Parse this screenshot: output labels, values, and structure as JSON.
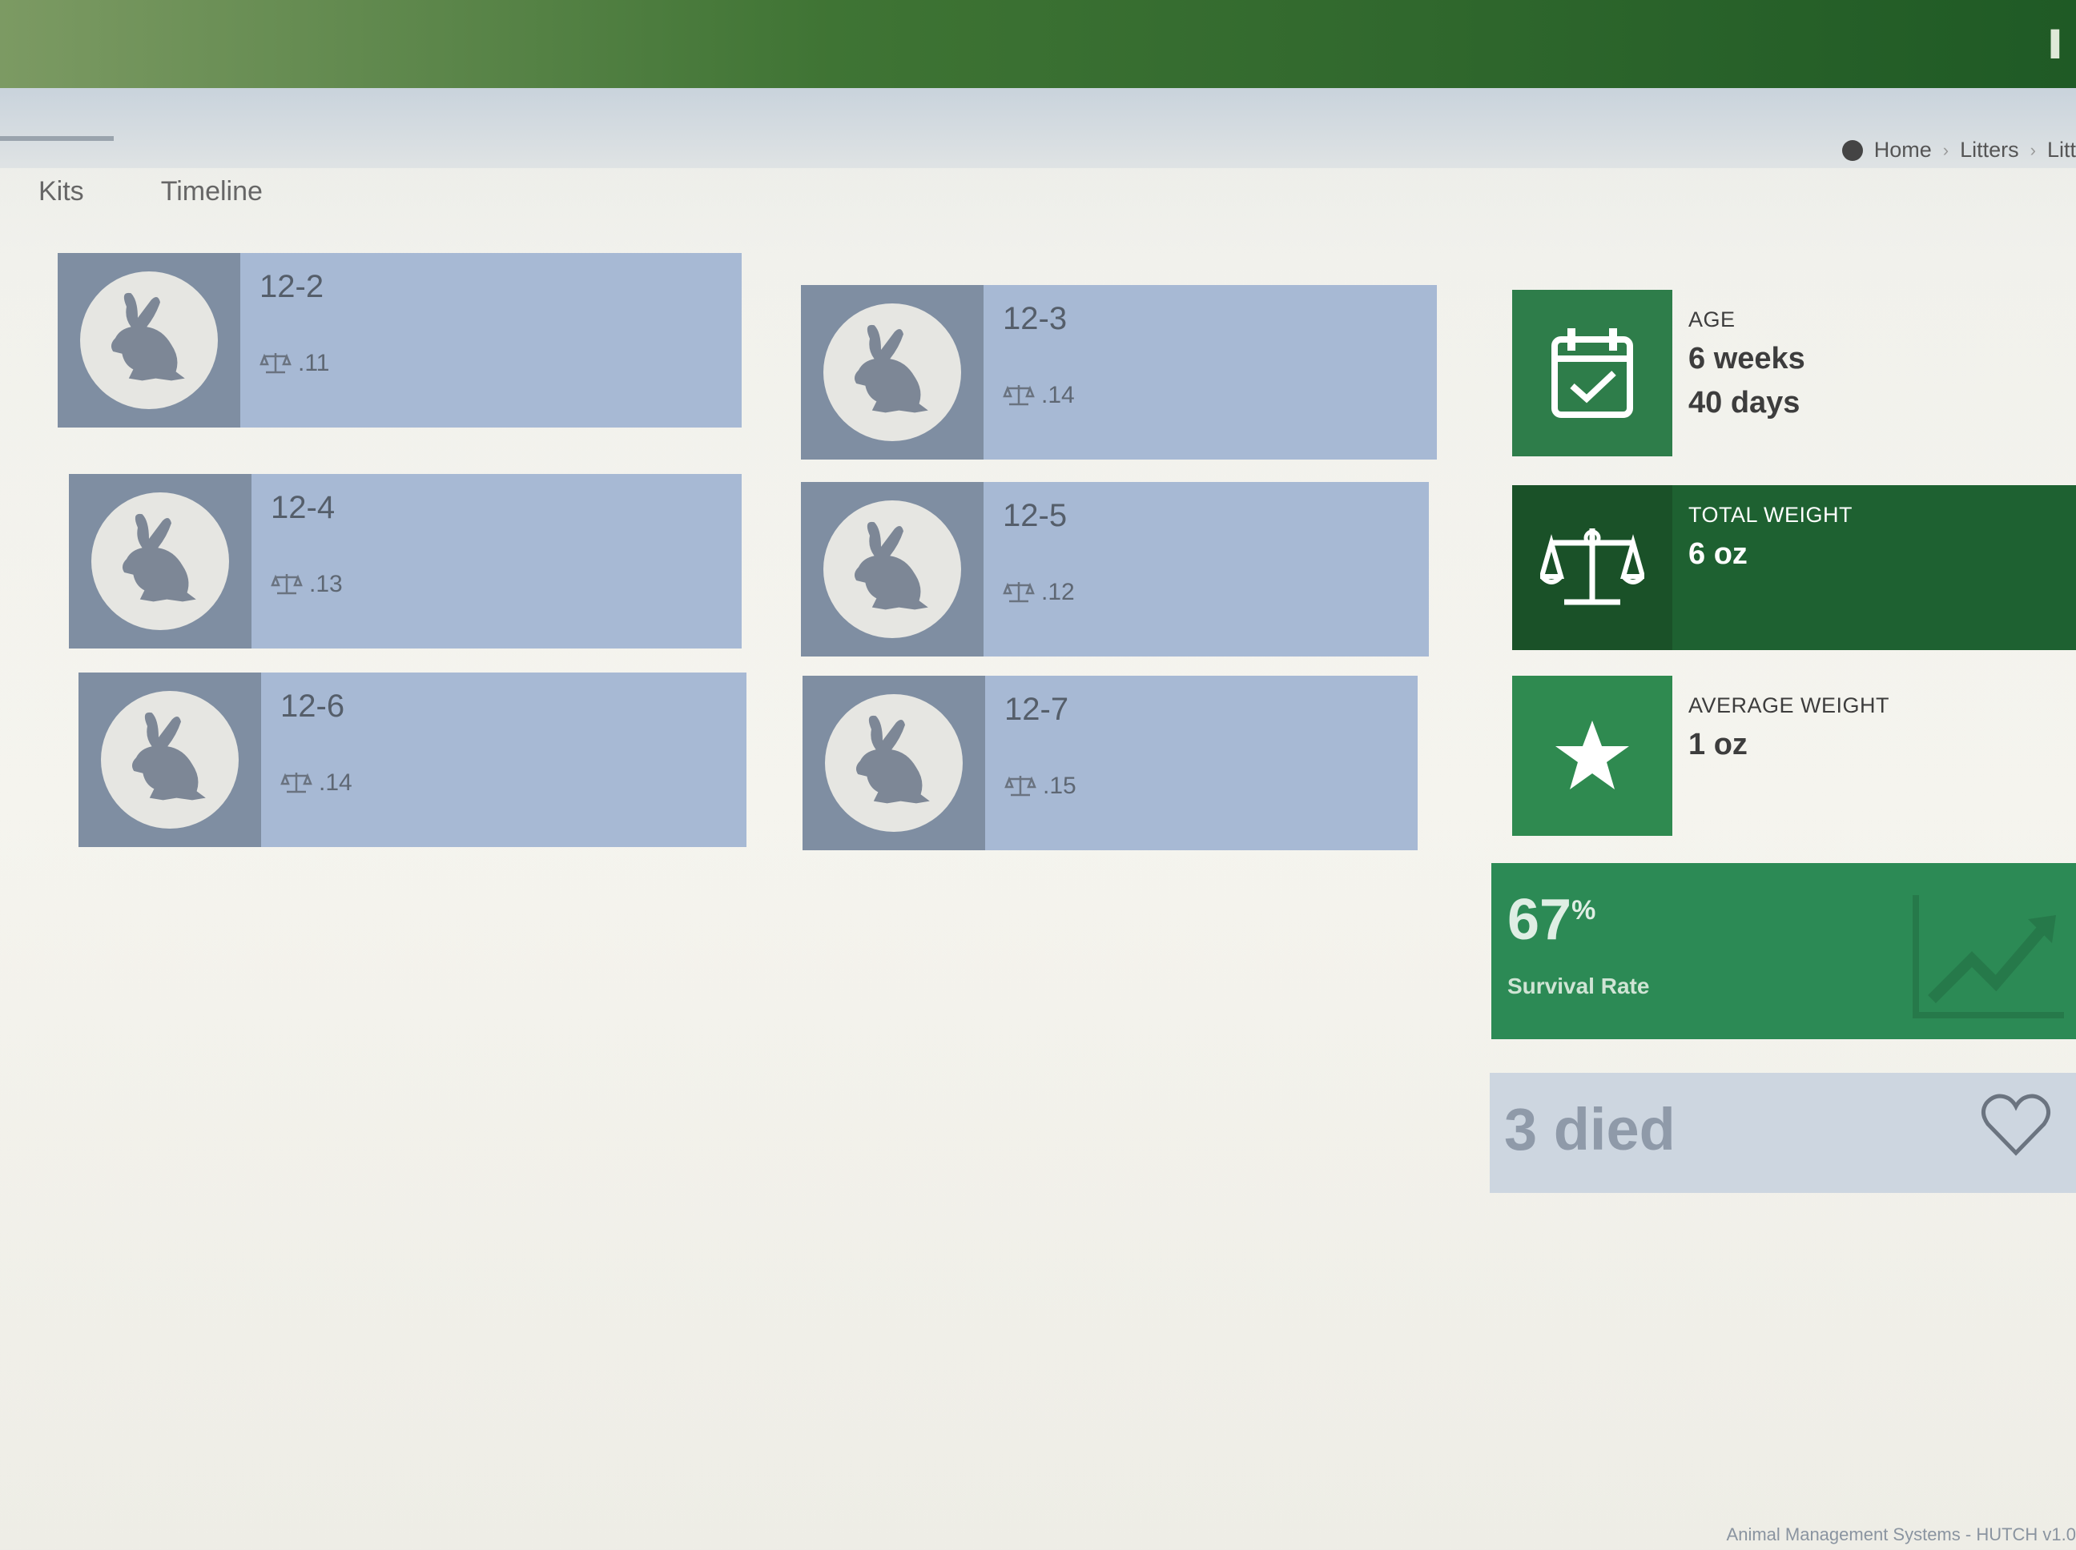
{
  "tabs": [
    {
      "label": "Kits",
      "active": true
    },
    {
      "label": "Timeline",
      "active": false
    }
  ],
  "breadcrumb": [
    "Home",
    "Litters",
    "Litt"
  ],
  "kits": [
    {
      "name": "12-2",
      "weight": ".11"
    },
    {
      "name": "12-3",
      "weight": ".14"
    },
    {
      "name": "12-4",
      "weight": ".13"
    },
    {
      "name": "12-5",
      "weight": ".12"
    },
    {
      "name": "12-6",
      "weight": ".14"
    },
    {
      "name": "12-7",
      "weight": ".15"
    }
  ],
  "stats": {
    "age": {
      "label": "AGE",
      "value_weeks": "6 weeks",
      "value_days": "40 days",
      "icon": "calendar-check-icon"
    },
    "total_weight": {
      "label": "TOTAL WEIGHT",
      "value": "6 oz",
      "icon": "scale-icon"
    },
    "average_weight": {
      "label": "AVERAGE WEIGHT",
      "value": "1 oz",
      "icon": "star-icon"
    },
    "survival": {
      "value": "67",
      "unit": "%",
      "label": "Survival Rate",
      "icon": "trend-chart-icon"
    },
    "died": {
      "value": "3 died",
      "icon": "heart-icon"
    }
  },
  "footer": "Animal Management Systems - HUTCH v1.0",
  "colors": {
    "kit_card": "#a7b9d4",
    "kit_thumb": "#7f8ea2",
    "green_dark": "#1e6131",
    "green": "#2e7d4a",
    "green_light": "#2c8a55",
    "died_tile": "#cdd6e0"
  }
}
